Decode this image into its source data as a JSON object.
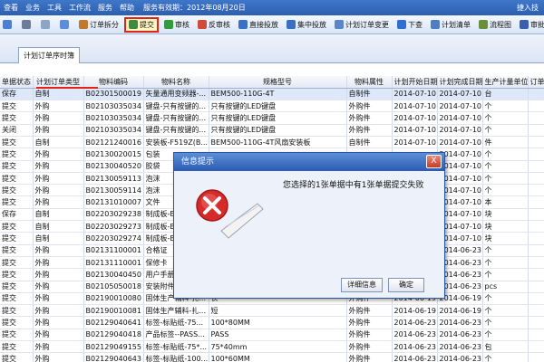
{
  "menu": {
    "items": [
      "查看",
      "业务",
      "工具",
      "工作流",
      "服务",
      "帮助"
    ],
    "expiry": "服务有效期：2012年08月20日",
    "user": "捷入技"
  },
  "toolbar": {
    "items": [
      {
        "label": "",
        "icon": "back-icon"
      },
      {
        "label": "",
        "icon": "print-icon"
      },
      {
        "label": "",
        "icon": "preview-icon"
      },
      {
        "label": "",
        "icon": "copy-icon"
      },
      {
        "label": "订单拆分",
        "icon": "split-icon"
      },
      {
        "label": "提交",
        "icon": "submit-icon"
      },
      {
        "label": "审核",
        "icon": "approve-icon"
      },
      {
        "label": "反审核",
        "icon": "unapprove-icon"
      },
      {
        "label": "直接投放",
        "icon": "release-icon"
      },
      {
        "label": "集中投放",
        "icon": "batch-release-icon"
      },
      {
        "label": "计划订单变更",
        "icon": "change-icon"
      },
      {
        "label": "下查",
        "icon": "query-icon"
      },
      {
        "label": "计划清单",
        "icon": "list-icon"
      },
      {
        "label": "流程图",
        "icon": "flow-icon"
      },
      {
        "label": "审批路径图",
        "icon": "path-icon"
      }
    ]
  },
  "tab": {
    "label": "计划订单序时簿"
  },
  "table": {
    "columns": [
      "单据状态",
      "计划订单类型",
      "物料编码",
      "物料名称",
      "规格型号",
      "物料属性",
      "计划开始日期",
      "计划完成日期",
      "生产计量单位",
      "订单"
    ],
    "rows": [
      [
        "保存",
        "自制",
        "B02301500019",
        "矢量通用变频器-...",
        "BEM500-110G-4T",
        "自制件",
        "2014-07-10",
        "2014-07-10",
        "台",
        ""
      ],
      [
        "提交",
        "外购",
        "B02103035034",
        "键盘-只有按键的...",
        "只有按键的LED键盘",
        "外购件",
        "2014-07-10",
        "2014-07-10",
        "个",
        ""
      ],
      [
        "提交",
        "外购",
        "B02103035034",
        "键盘-只有按键的...",
        "只有按键的LED键盘",
        "外购件",
        "2014-07-10",
        "2014-07-10",
        "个",
        ""
      ],
      [
        "关闭",
        "外购",
        "B02103035034",
        "键盘-只有按键的...",
        "只有按键的LED键盘",
        "外购件",
        "2014-07-10",
        "2014-07-10",
        "个",
        ""
      ],
      [
        "提交",
        "自制",
        "B02121240016",
        "安装板-F519Z(B...",
        "BEM500-110G-4T风扇安装板",
        "自制件",
        "2014-07-10",
        "2014-07-10",
        "件",
        ""
      ],
      [
        "提交",
        "外购",
        "B02130020015",
        "包装",
        "",
        "",
        "",
        "2014-07-10",
        "个",
        ""
      ],
      [
        "提交",
        "外购",
        "B02130040520",
        "胶袋",
        "",
        "",
        "",
        "2014-07-10",
        "个",
        ""
      ],
      [
        "提交",
        "外购",
        "B02130059113",
        "泡沫",
        "",
        "",
        "",
        "2014-07-10",
        "个",
        ""
      ],
      [
        "提交",
        "外购",
        "B02130059114",
        "泡沫",
        "",
        "",
        "",
        "2014-07-10",
        "个",
        ""
      ],
      [
        "提交",
        "外购",
        "B02131010007",
        "文件",
        "",
        "",
        "",
        "2014-07-10",
        "本",
        ""
      ],
      [
        "保存",
        "自制",
        "B02203029238",
        "制成板-B",
        "",
        "",
        "",
        "2014-07-10",
        "块",
        ""
      ],
      [
        "提交",
        "自制",
        "B02203029273",
        "制成板-B",
        "",
        "",
        "",
        "2014-07-10",
        "块",
        ""
      ],
      [
        "提交",
        "自制",
        "B02203029274",
        "制成板-B",
        "",
        "",
        "",
        "2014-07-10",
        "块",
        ""
      ],
      [
        "提交",
        "外购",
        "B02131100001",
        "合格证",
        "",
        "",
        "",
        "2014-06-23",
        "个",
        ""
      ],
      [
        "提交",
        "外购",
        "B02131110001",
        "保修卡",
        "",
        "",
        "",
        "2014-06-23",
        "个",
        ""
      ],
      [
        "提交",
        "外购",
        "B02130040450",
        "用户手册",
        "",
        "",
        "",
        "2014-06-23",
        "个",
        ""
      ],
      [
        "提交",
        "外购",
        "B02105050018",
        "安装附件",
        "",
        "",
        "",
        "2014-06-23",
        "pcs",
        ""
      ],
      [
        "提交",
        "外购",
        "B02190010080",
        "固体生产辅料-扎...",
        "长",
        "外购件",
        "2014-06-19",
        "2014-06-19",
        "个",
        ""
      ],
      [
        "提交",
        "外购",
        "B02190010081",
        "固体生产辅料-扎...",
        "短",
        "外购件",
        "2014-06-19",
        "2014-06-19",
        "个",
        ""
      ],
      [
        "提交",
        "外购",
        "B02129040641",
        "标签-标贴纸-75...",
        "100*80MM",
        "外购件",
        "2014-06-23",
        "2014-06-23",
        "个",
        ""
      ],
      [
        "提交",
        "外购",
        "B02129040418",
        "产品标签--PASS...",
        "PASS",
        "外购件",
        "2014-06-23",
        "2014-06-23",
        "个",
        ""
      ],
      [
        "提交",
        "外购",
        "B02129049155",
        "标签-标贴纸-75*...",
        "75*40mm",
        "外购件",
        "2014-06-23",
        "2014-06-23",
        "包",
        ""
      ],
      [
        "提交",
        "外购",
        "B02129040643",
        "标签-标贴纸-100...",
        "100*60MM",
        "外购件",
        "2014-06-23",
        "2014-06-23",
        "个",
        ""
      ]
    ]
  },
  "dialog": {
    "title": "信息提示",
    "message": "您选择的1张单据中有1张单据提交失败",
    "details_button": "详细信息",
    "ok_button": "确定",
    "close_glyph": "X"
  },
  "colors": {
    "menubar": "#2e5fb0",
    "selected_row": "#dde9fb",
    "annotation_red": "#e2231a",
    "dialog_title": "#2b5bb3"
  }
}
